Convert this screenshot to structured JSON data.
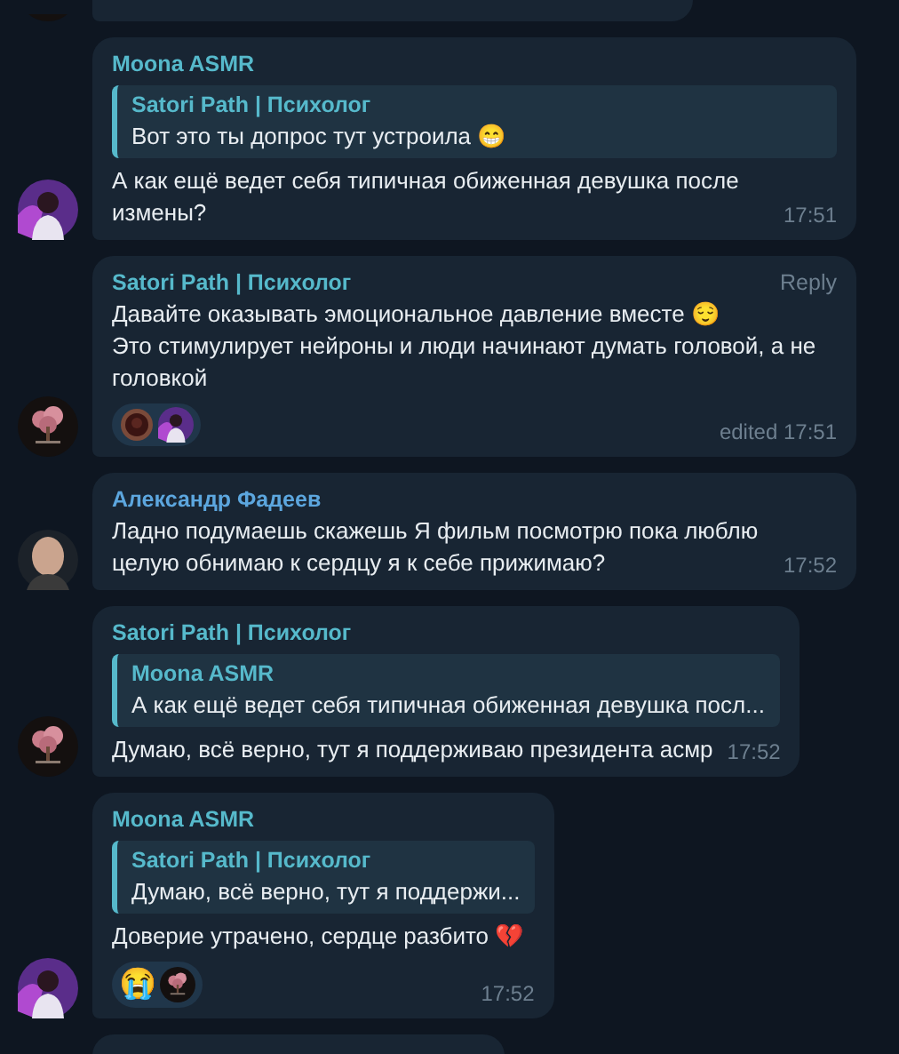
{
  "messages": [
    {
      "kind": "cut_top",
      "avatar": {
        "kind": "tree"
      }
    },
    {
      "kind": "message",
      "avatar": {
        "kind": "girl"
      },
      "sender": "Moona ASMR",
      "color": "#56b9cb",
      "reply": {
        "sender": "Satori Path | Психолог",
        "color": "#56b9cb",
        "text": "Вот это ты допрос тут устроила 😁"
      },
      "text": "А как ещё ведет себя типичная обиженная девушка после измены?",
      "time": "17:51"
    },
    {
      "kind": "message",
      "avatar": {
        "kind": "tree"
      },
      "sender": "Satori Path | Психолог",
      "color": "#56b9cb",
      "reply_button": "Reply",
      "text": "Давайте оказывать эмоциональное давление вместе 😌\nЭто стимулирует нейроны и люди начинают думать головой, а не головкой",
      "reactions": [
        {
          "kind": "sticker",
          "reactor": {
            "kind": "girl"
          }
        }
      ],
      "time": "edited 17:51"
    },
    {
      "kind": "message",
      "avatar": {
        "kind": "man"
      },
      "sender": "Александр Фадеев",
      "color": "#5ca6de",
      "text": "Ладно подумаешь скажешь Я фильм посмотрю пока люблю целую обнимаю к сердцу я к себе прижимаю?",
      "time": "17:52"
    },
    {
      "kind": "message",
      "avatar": {
        "kind": "tree"
      },
      "sender": "Satori Path | Психолог",
      "color": "#56b9cb",
      "reply": {
        "sender": "Moona ASMR",
        "color": "#56b9cb",
        "text": "А как ещё ведет себя типичная обиженная девушка посл..."
      },
      "text": "Думаю, всё верно, тут я поддерживаю президента асмр",
      "time": "17:52"
    },
    {
      "kind": "message",
      "avatar": {
        "kind": "girl"
      },
      "sender": "Moona ASMR",
      "color": "#56b9cb",
      "reply": {
        "sender": "Satori Path | Психолог",
        "color": "#56b9cb",
        "text": "Думаю, всё верно, тут я поддержи..."
      },
      "text": "Доверие утрачено, сердце разбито 💔",
      "reactions": [
        {
          "kind": "emoji",
          "emoji": "😭",
          "reactor": {
            "kind": "tree"
          }
        }
      ],
      "time": "17:52"
    },
    {
      "kind": "cut_bottom"
    }
  ]
}
